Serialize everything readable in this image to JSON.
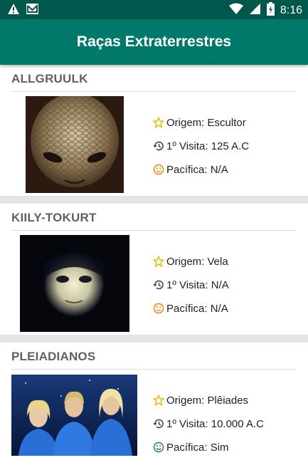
{
  "status_bar": {
    "time": "8:16",
    "icons": [
      "warning-icon",
      "mail-icon",
      "wifi-icon",
      "signal-icon",
      "battery-icon"
    ]
  },
  "app_bar": {
    "title": "Raças Extraterrestres"
  },
  "colors": {
    "status_bar": "#00574b",
    "app_bar": "#00796b",
    "star": "#e6b800",
    "history": "#444444",
    "face_neutral": "#f57c00",
    "face_happy": "#2e7d32"
  },
  "races": [
    {
      "name": "ALLGRUULK",
      "origem": "Origem: Escultor",
      "visita": "1º Visita: 125 A.C",
      "pacifica": "Pacífica: N/A",
      "mood": "neutral"
    },
    {
      "name": "KIILY-TOKURT",
      "origem": "Origem: Vela",
      "visita": "1º Visita: N/A",
      "pacifica": "Pacífica: N/A",
      "mood": "neutral"
    },
    {
      "name": "PLEIADIANOS",
      "origem": "Origem: Plêiades",
      "visita": "1º Visita: 10.000 A.C",
      "pacifica": "Pacífica: Sim",
      "mood": "happy"
    }
  ]
}
